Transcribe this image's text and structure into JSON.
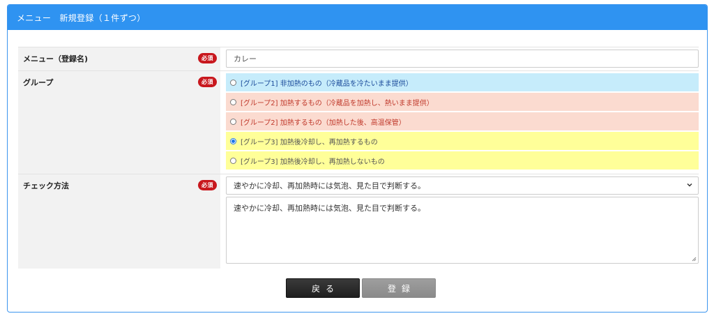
{
  "header": {
    "title": "メニュー　新規登録（１件ずつ）"
  },
  "required_badge": "必須",
  "fields": {
    "menu_name": {
      "label": "メニュー（登録名)",
      "value": "カレー"
    },
    "group": {
      "label": "グループ",
      "options": [
        {
          "text": "[グループ1] 非加熱のもの（冷蔵品を冷たいまま提供）",
          "bg": "#c6ecfb",
          "color": "#1a4a9a",
          "checked": false
        },
        {
          "text": "[グループ2] 加熱するもの（冷蔵品を加熱し、熱いまま提供）",
          "bg": "#fbdbd0",
          "color": "#c0392b",
          "checked": false
        },
        {
          "text": "[グループ2] 加熱するもの（加熱した後、高温保管）",
          "bg": "#fbdbd0",
          "color": "#c0392b",
          "checked": false
        },
        {
          "text": "[グループ3] 加熱後冷却し、再加熱するもの",
          "bg": "#ffff99",
          "color": "#555555",
          "checked": true
        },
        {
          "text": "[グループ3] 加熱後冷却し、再加熱しないもの",
          "bg": "#ffff99",
          "color": "#555555",
          "checked": false
        }
      ]
    },
    "check_method": {
      "label": "チェック方法",
      "selected": "速やかに冷却、再加熱時には気泡、見た目で判断する。",
      "textarea": "速やかに冷却、再加熱時には気泡、見た目で判断する。"
    }
  },
  "buttons": {
    "back": "戻る",
    "submit": "登録"
  }
}
